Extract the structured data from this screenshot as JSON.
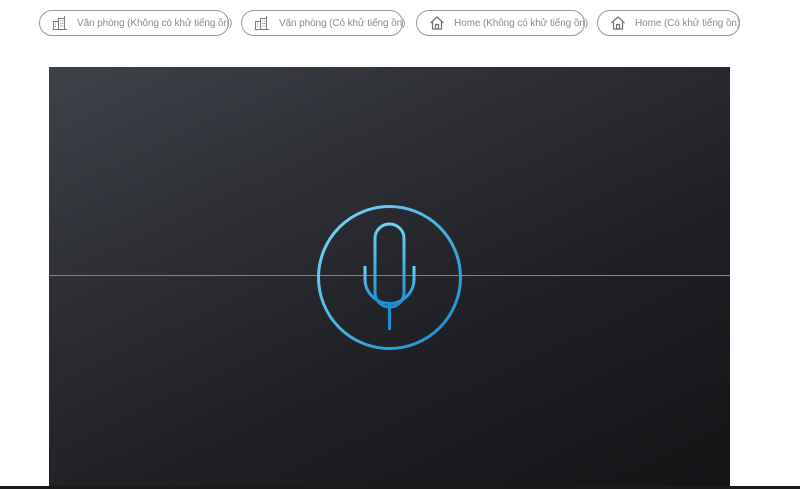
{
  "tabs": [
    {
      "label": "Văn phòng (Không có khử tiếng ồn)",
      "icon": "office-building-icon"
    },
    {
      "label": "Văn phòng (Có khử tiếng ồn)",
      "icon": "office-building-icon"
    },
    {
      "label": "Home (Không có khử tiếng ồn)",
      "icon": "home-icon"
    },
    {
      "label": "Home (Có khử tiếng ồn)",
      "icon": "home-icon"
    }
  ],
  "stage": {
    "mic_icon": "microphone-icon",
    "accent_color": "#2a9fd6",
    "background_color": "#2b2d32"
  }
}
